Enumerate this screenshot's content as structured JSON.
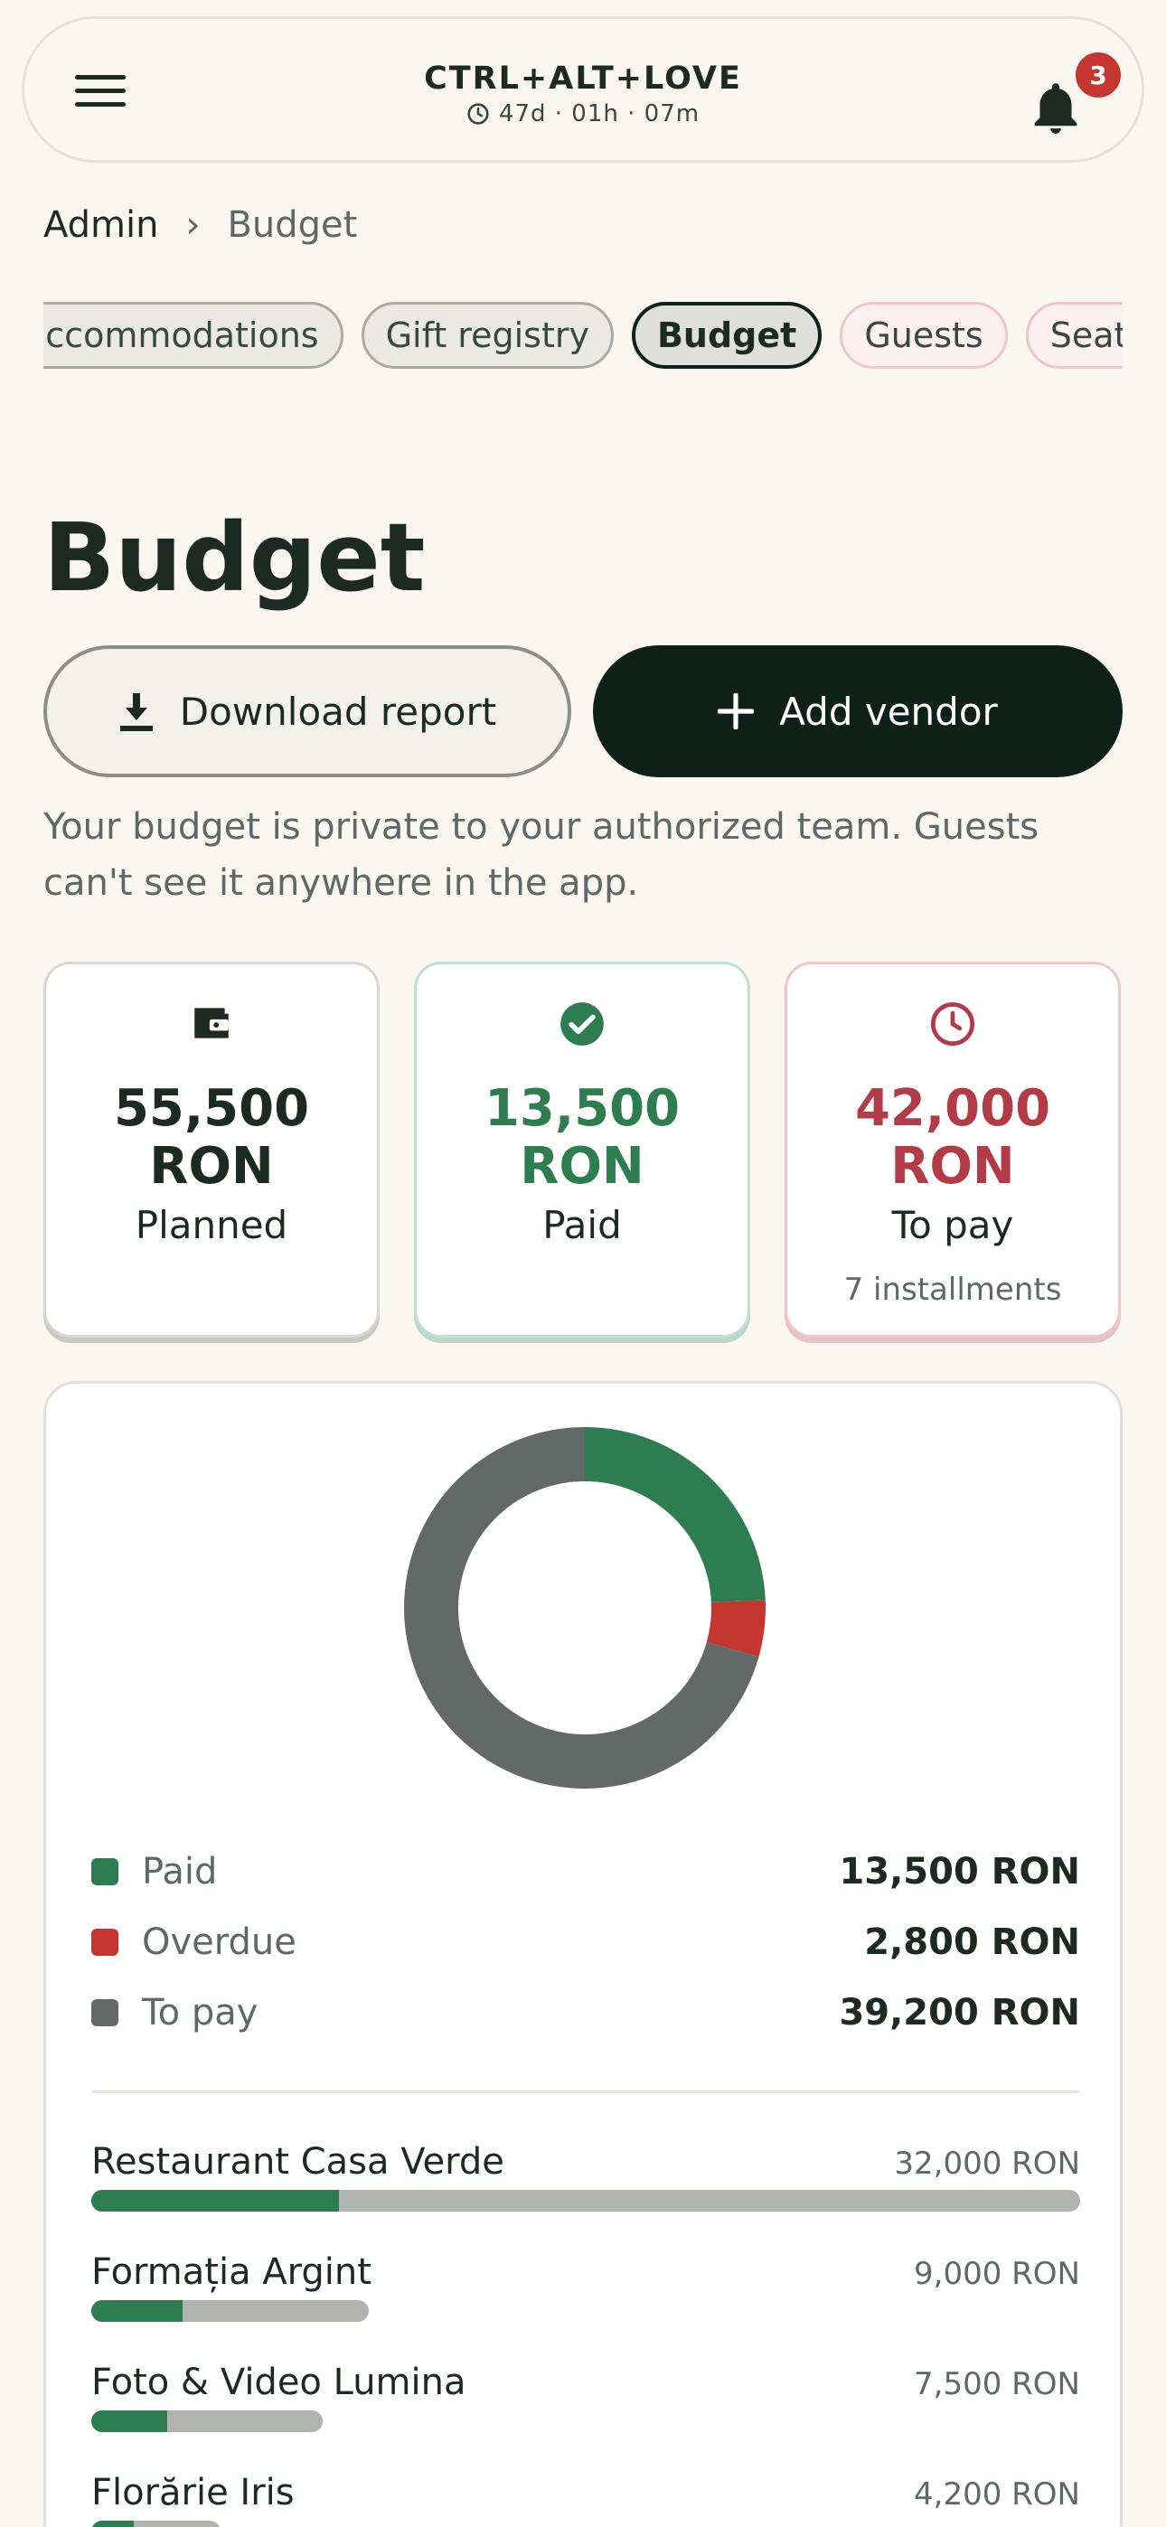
{
  "header": {
    "title": "CTRL+ALT+LOVE",
    "countdown": "47d · 01h · 07m",
    "notification_count": "3"
  },
  "breadcrumb": {
    "parent": "Admin",
    "separator": "›",
    "current": "Budget"
  },
  "tabs": [
    {
      "label": "accommodations",
      "state": "default"
    },
    {
      "label": "Gift registry",
      "state": "default"
    },
    {
      "label": "Budget",
      "state": "active"
    },
    {
      "label": "Guests",
      "state": "pink"
    },
    {
      "label": "Seating",
      "state": "pink"
    }
  ],
  "page": {
    "title": "Budget",
    "download_label": "Download report",
    "add_vendor_label": "Add vendor",
    "privacy_note": "Your budget is private to your authorized team. Guests can't see it anywhere in the app."
  },
  "stats": {
    "planned": {
      "amount": "55,500",
      "currency": "RON",
      "label": "Planned"
    },
    "paid": {
      "amount": "13,500",
      "currency": "RON",
      "label": "Paid"
    },
    "to_pay": {
      "amount": "42,000",
      "currency": "RON",
      "label": "To pay",
      "sub": "7 installments"
    }
  },
  "colors": {
    "paid": "#2e7d51",
    "overdue": "#c4362f",
    "to_pay": "#636966",
    "track": "#b1b3b0",
    "dark": "#0f2019"
  },
  "chart_data": {
    "type": "pie",
    "categories": [
      "Paid",
      "Overdue",
      "To pay"
    ],
    "values": [
      13500,
      2800,
      39200
    ],
    "unit": "RON"
  },
  "legend": [
    {
      "name": "Paid",
      "value": "13,500 RON",
      "color": "#2e7d51"
    },
    {
      "name": "Overdue",
      "value": "2,800 RON",
      "color": "#c4362f"
    },
    {
      "name": "To pay",
      "value": "39,200 RON",
      "color": "#636966"
    }
  ],
  "vendors": [
    {
      "name": "Restaurant Casa Verde",
      "amount": "32,000 RON",
      "bar_length_fraction": 1.0,
      "paid_fraction": 0.25
    },
    {
      "name": "Formația Argint",
      "amount": "9,000 RON",
      "bar_length_fraction": 0.281,
      "paid_fraction": 0.33
    },
    {
      "name": "Foto & Video Lumina",
      "amount": "7,500 RON",
      "bar_length_fraction": 0.234,
      "paid_fraction": 0.33
    },
    {
      "name": "Florărie Iris",
      "amount": "4,200 RON",
      "bar_length_fraction": 0.131,
      "paid_fraction": 0.33
    }
  ]
}
